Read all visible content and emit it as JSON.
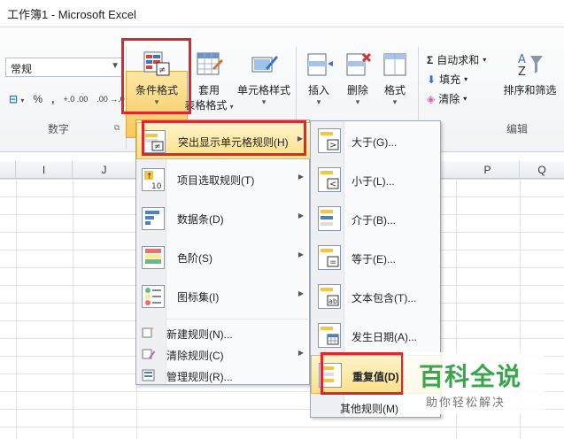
{
  "window": {
    "title": "工作簿1  -  Microsoft Excel"
  },
  "number_group": {
    "format_value": "常规",
    "percent": "%",
    "comma": ",",
    "inc_decimal": "+.0 .00",
    "dec_decimal": ".00 →.0",
    "label": "数字"
  },
  "styles_group": {
    "conditional_formatting": "条件格式",
    "table_format_line1": "套用",
    "table_format_line2": "表格格式",
    "cell_styles": "单元格样式"
  },
  "cells_group": {
    "insert": "插入",
    "delete": "删除",
    "format": "格式"
  },
  "editing_group": {
    "autosum": "自动求和",
    "fill": "填充",
    "clear": "清除",
    "sort_filter": "排序和筛选",
    "label": "编辑"
  },
  "columns": [
    "I",
    "J",
    "P",
    "Q"
  ],
  "cf_menu": {
    "items": [
      {
        "label": "突出显示单元格规则(H)"
      },
      {
        "label": "项目选取规则(T)"
      },
      {
        "label": "数据条(D)"
      },
      {
        "label": "色阶(S)"
      },
      {
        "label": "图标集(I)"
      }
    ],
    "small_items": [
      {
        "label": "新建规则(N)..."
      },
      {
        "label": "清除规则(C)"
      },
      {
        "label": "管理规则(R)..."
      }
    ]
  },
  "highlight_submenu": {
    "items": [
      {
        "label": "大于(G)..."
      },
      {
        "label": "小于(L)..."
      },
      {
        "label": "介于(B)..."
      },
      {
        "label": "等于(E)..."
      },
      {
        "label": "文本包含(T)..."
      },
      {
        "label": "发生日期(A)..."
      },
      {
        "label": "重复值(D)"
      }
    ],
    "other_rules": "其他规则(M)"
  },
  "watermark": {
    "brand": "百科全说",
    "slogan": "助你轻松解决"
  },
  "colors": {
    "highlight_red": "#e0262c",
    "menu_hover": "#fde08a",
    "brand_green": "#3aa64c"
  }
}
